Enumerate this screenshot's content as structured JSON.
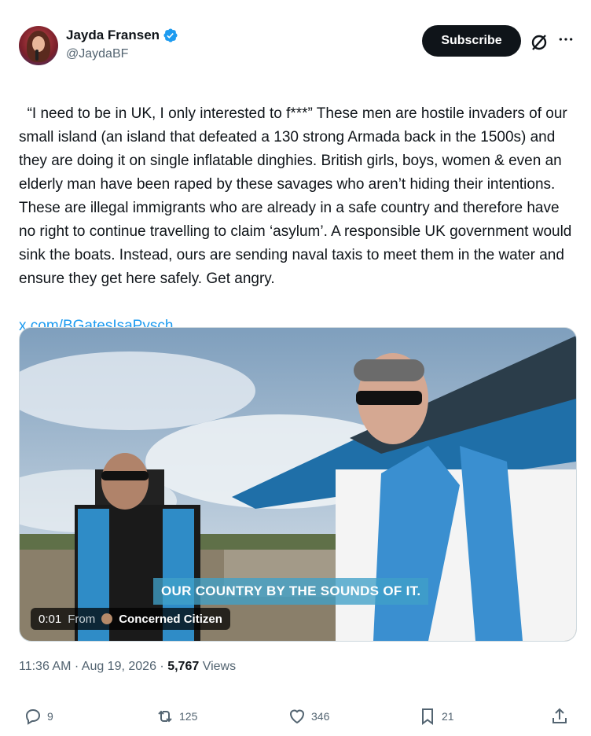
{
  "author": {
    "display_name": "Jayda Fransen",
    "handle": "@JaydaBF",
    "verified_icon": "verified-badge-icon",
    "verified_color": "#1d9bf0"
  },
  "header": {
    "subscribe_label": "Subscribe",
    "grok_icon": "grok-icon",
    "more_icon": "more-icon"
  },
  "tweet": {
    "text": "“I need to be in UK, I only interested to f***” These men are hostile invaders of our small island (an island that defeated a 130 strong Armada back in the 1500s) and they are doing it on single inflatable dinghies. British girls, boys, women & even an elderly man have been raped by these savages who aren’t hiding their intentions. These are illegal immigrants who are already in a safe country and therefore have no right to continue travelling to claim ‘asylum’. A responsible UK government would sink the boats. Instead, ours are sending naval taxis to meet them in the water and ensure they get here safely. Get angry.",
    "link": "x.com/BGatesIsaPysch…",
    "link_color": "#1d9bf0"
  },
  "media": {
    "caption": "OUR COUNTRY BY THE SOUNDS OF IT.",
    "time": "0:01",
    "from_label": "From",
    "source": "Concerned Citizen"
  },
  "meta": {
    "time": "11:36 AM",
    "date": "Aug 19, 2026",
    "sep": "·",
    "views_count": "5,767",
    "views_label": "Views"
  },
  "actions": {
    "replies": "9",
    "reposts": "125",
    "likes": "346",
    "bookmarks": "21"
  },
  "colors": {
    "text": "#0f1419",
    "secondary": "#536471",
    "button_bg": "#0f1419"
  }
}
